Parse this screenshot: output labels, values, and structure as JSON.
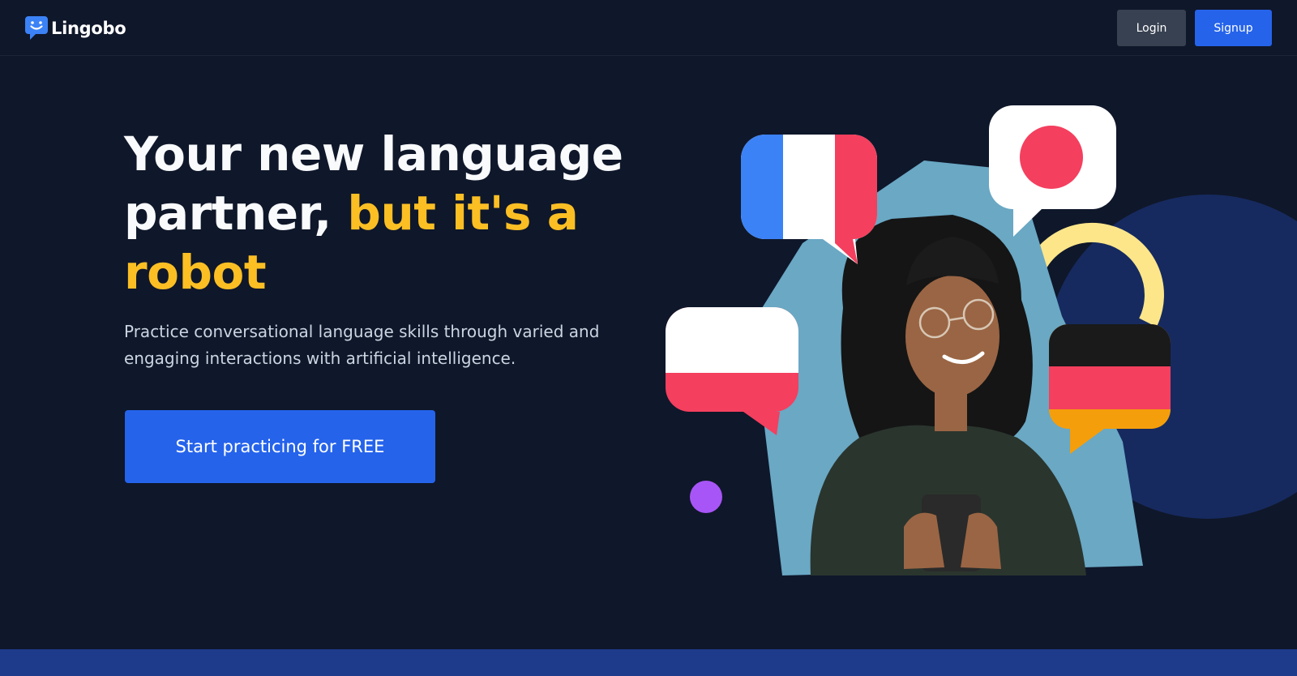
{
  "brand": {
    "name": "Lingobo",
    "icon": "chat-bubble-smile-icon",
    "color": "#3b82f6"
  },
  "nav": {
    "login_label": "Login",
    "signup_label": "Signup"
  },
  "hero": {
    "title_part1": "Your new language partner, ",
    "title_highlight": "but it's a robot",
    "subtitle": "Practice conversational language skills through varied and engaging interactions with artificial intelligence.",
    "cta_label": "Start practicing for FREE"
  },
  "illustration": {
    "flags": [
      "france-flag",
      "japan-flag",
      "poland-flag",
      "germany-flag"
    ],
    "person": "smiling-woman-holding-phone"
  },
  "colors": {
    "background": "#0f172a",
    "accent": "#2563eb",
    "highlight": "#fbbf24",
    "secondary_button": "#374151",
    "bottom_band": "#1e3a8a"
  }
}
